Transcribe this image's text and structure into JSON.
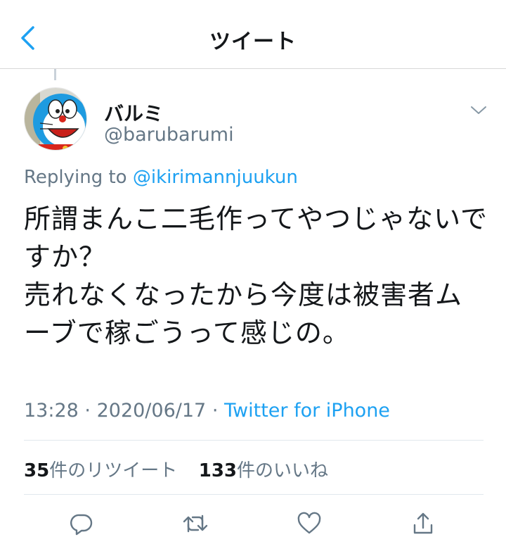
{
  "nav": {
    "title": "ツイート",
    "back_icon": "chevron-left-icon"
  },
  "tweet": {
    "display_name": "バルミ",
    "handle": "@barubarumi",
    "replying_prefix": "Replying to",
    "replying_to": "@ikirimannjuukun",
    "text": "所謂まんこ二毛作ってやつじゃないですか？\n売れなくなったから今度は被害者ムーブで稼ごうって感じの。",
    "time": "13:28",
    "date": "2020/06/17",
    "separator": "·",
    "source": "Twitter for iPhone"
  },
  "stats": {
    "retweet_count": "35",
    "retweet_label": "件のリツイート",
    "like_count": "133",
    "like_label": "件のいいね"
  },
  "actions": [
    "reply-icon",
    "retweet-icon",
    "like-icon",
    "share-icon"
  ],
  "colors": {
    "accent": "#1da1f2",
    "muted": "#657786",
    "text": "#14171a",
    "divider": "#e1e8ed"
  }
}
